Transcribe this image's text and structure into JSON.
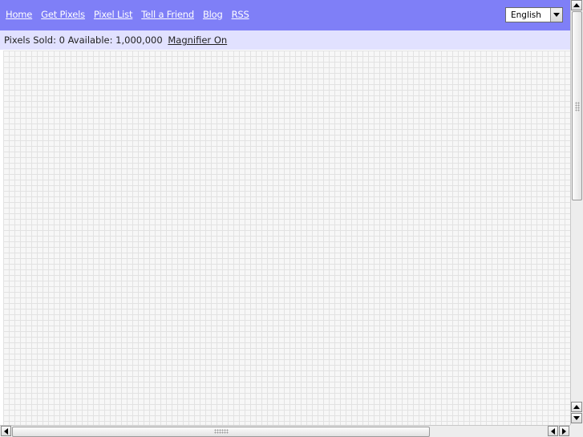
{
  "nav": {
    "items": [
      "Home",
      "Get Pixels",
      "Pixel List",
      "Tell a Friend",
      "Blog",
      "RSS"
    ]
  },
  "language": {
    "selected": "English"
  },
  "status": {
    "text": "Pixels Sold: 0 Available: 1,000,000",
    "magnifier_label": "Magnifier On"
  },
  "colors": {
    "nav_background": "#7f7ff7",
    "status_background": "#e1e1ff",
    "grid_background": "#f7f7f7",
    "grid_lines": "#e2e2e2"
  },
  "icons": {
    "language_dropdown": "chevron-down-icon",
    "scroll_up": "arrow-up-icon",
    "scroll_down": "arrow-down-icon",
    "scroll_left": "arrow-left-icon",
    "scroll_right": "arrow-right-icon"
  }
}
